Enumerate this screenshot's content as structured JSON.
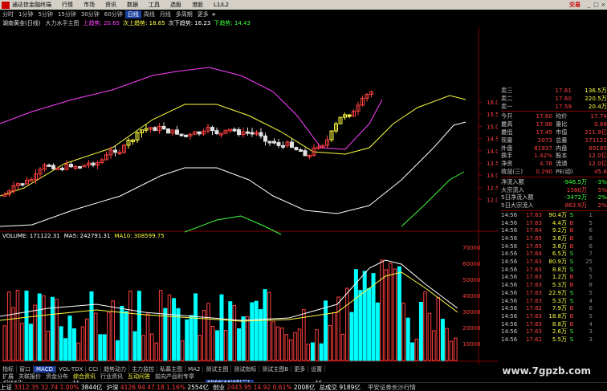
{
  "titlebar": {
    "app": "通达信金融终端",
    "menu": [
      "行情",
      "市场",
      "资讯",
      "数据",
      "工具",
      "选股",
      "港股",
      "L1/L2"
    ],
    "brand": "交易"
  },
  "periods": [
    "分时",
    "1分钟",
    "5分钟",
    "15分钟",
    "30分钟",
    "60分钟",
    "日线",
    "周线",
    "月线",
    "多周期",
    "更多"
  ],
  "active_period": "日线",
  "infobar": {
    "stock": "湖南黄金(日线)",
    "indicator": "大力水手主图",
    "l1": "上趋势: 20.65",
    "l2": "次上趋势: 18.65",
    "l3": "次下趋势: 16.23",
    "l4": "下趋势: 14.43"
  },
  "price_axis": [
    "16.00",
    "15.50",
    "15.00",
    "14.50",
    "14.00",
    "13.50",
    "13.00",
    "12.50",
    "12.00"
  ],
  "vol_axis": [
    "70000",
    "60000",
    "50000",
    "40000",
    "30000",
    "20000",
    "10000"
  ],
  "vol_info": {
    "label": "VOLUME: 171122.31",
    "ma5": "MA5: 242791.31",
    "ma10": "MA10: 308599.75"
  },
  "date_labels": [
    "2022年",
    "11",
    "2022/11/28(一)",
    "12"
  ],
  "quote": {
    "ask": [
      [
        "卖三",
        "17.61",
        "136.5万"
      ],
      [
        "卖二",
        "17.60",
        "220.5万"
      ],
      [
        "卖一",
        "17.59",
        "20.4万"
      ]
    ],
    "rows": [
      [
        "今开",
        "17.60",
        "均价",
        "17.74"
      ],
      [
        "最高",
        "17.98",
        "量比",
        "0.68"
      ],
      [
        "最低",
        "17.45",
        "市值",
        "211.9亿"
      ],
      [
        "现量",
        "2073",
        "总量",
        "171122"
      ],
      [
        "外盘",
        "81937",
        "内盘",
        "89185"
      ],
      [
        "换手",
        "1.42%",
        "股本",
        "12.0亿"
      ],
      [
        "净资",
        "4.78",
        "流通",
        "12.0亿"
      ],
      [
        "收益(三)",
        "0.290",
        "PE(动)",
        "45.6"
      ]
    ],
    "flows": [
      [
        "净流入额",
        "-946.5万",
        "-3%"
      ],
      [
        "大宗流入",
        "1580万",
        "5%"
      ],
      [
        "5日净流入额",
        "-3472万",
        "-2%"
      ],
      [
        "5日大宗流入",
        "863.9万",
        "2%"
      ]
    ]
  },
  "ticks": [
    [
      "14:56",
      "17.63",
      "90.4万",
      "S",
      "1"
    ],
    [
      "14:56",
      "17.63",
      "4.4万",
      "B",
      "5"
    ],
    [
      "14:56",
      "17.64",
      "9.2万",
      "B",
      "6"
    ],
    [
      "14:56",
      "17.65",
      "3.8万",
      "B",
      "6"
    ],
    [
      "14:56",
      "17.65",
      "3.8万",
      "B",
      "6"
    ],
    [
      "14:56",
      "17.64",
      "6.5万",
      "S",
      "7"
    ],
    [
      "14:56",
      "17.63",
      "80.9万",
      "S",
      "25"
    ],
    [
      "14:56",
      "17.63",
      "8.8万",
      "S",
      "5"
    ],
    [
      "14:56",
      "17.63",
      "1.2万",
      "B",
      "5"
    ],
    [
      "14:56",
      "17.63",
      "5.3万",
      "B",
      "8"
    ],
    [
      "14:56",
      "17.63",
      "22.9万",
      "S",
      "5"
    ],
    [
      "14:56",
      "17.63",
      "5.3万",
      "S",
      "4"
    ],
    [
      "14:56",
      "17.62",
      "7.9万",
      "B",
      "6"
    ],
    [
      "14:56",
      "17.63",
      "18.8万",
      "B",
      "5"
    ],
    [
      "14:56",
      "17.63",
      "8.8万",
      "B",
      "4"
    ],
    [
      "14:56",
      "17.63",
      "2.6万",
      "S",
      "3"
    ],
    [
      "14:56",
      "17.62",
      "5.5万",
      "S",
      "3"
    ]
  ],
  "tabs": [
    "指标",
    "窗口",
    "MACD",
    "VOL-TDX",
    "CCI",
    "趋势动力",
    "主力监控",
    "私募主图",
    "MA2",
    "测试主图",
    "测试指标",
    "测试主图B",
    "更多",
    "设置"
  ],
  "active_tab": "MACD",
  "tabs2": [
    "扩展",
    "关联报价",
    "资金分布",
    "综合资讯",
    "行业资讯",
    "互动问答",
    "前向产品利专章"
  ],
  "status": [
    {
      "name": "上证",
      "val": "3312.35",
      "chg": "32.74",
      "pct": "1.00%",
      "amt": "3844亿"
    },
    {
      "name": "沪深",
      "val": "4126.94",
      "chg": "47.18",
      "pct": "1.16%",
      "amt": "2554亿"
    },
    {
      "name": "创业",
      "val": "2443.95",
      "chg": "14.92",
      "pct": "0.61%",
      "amt": "2008亿"
    },
    {
      "name": "总成交",
      "val": "9189亿"
    }
  ],
  "status_extra": "平安证券长沙行情",
  "watermark": "www.7gpzb.com",
  "colors": {
    "up": "#ff4040",
    "down": "#00ffff",
    "ma_yellow": "#ffff40",
    "band_magenta": "#ff40ff"
  }
}
